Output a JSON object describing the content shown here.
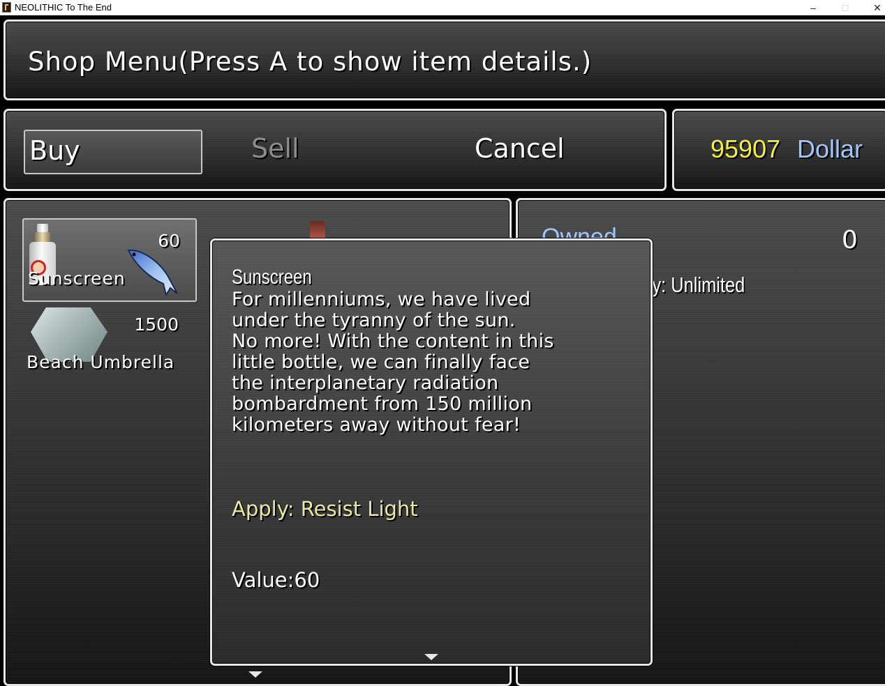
{
  "window": {
    "title": "NEOLITHIC To The End",
    "minimize_glyph": "–",
    "maximize_glyph": "□",
    "close_glyph": "✕"
  },
  "help": {
    "text": "Shop Menu(Press A to show item details.)"
  },
  "commands": {
    "buy": "Buy",
    "sell": "Sell",
    "cancel": "Cancel"
  },
  "gold": {
    "amount": "95907",
    "unit": "Dollar",
    "amount_color": "#f7f032",
    "unit_color": "#9ec6ff"
  },
  "shop_items": [
    {
      "name": "Sunscreen",
      "price": "60",
      "icon": "sunscreen-bottle-icon",
      "selected": true
    },
    {
      "name": "Beach Umbrella",
      "price": "1500",
      "icon": "rock-icon",
      "selected": false
    }
  ],
  "status": {
    "owned_label": "Owned",
    "owned_value": "0",
    "inventory_text": "ry: Unlimited"
  },
  "detail": {
    "name": "Sunscreen",
    "description": "For millenniums, we have lived\nunder the tyranny of the sun.\nNo more! With the content in this\nlittle bottle, we can finally face\nthe interplanetary radiation\nbombardment from 150 million\nkilometers away without fear!",
    "effect": "Apply: Resist Light",
    "value": "Value:60",
    "effect_color": "#e8e8a0"
  }
}
